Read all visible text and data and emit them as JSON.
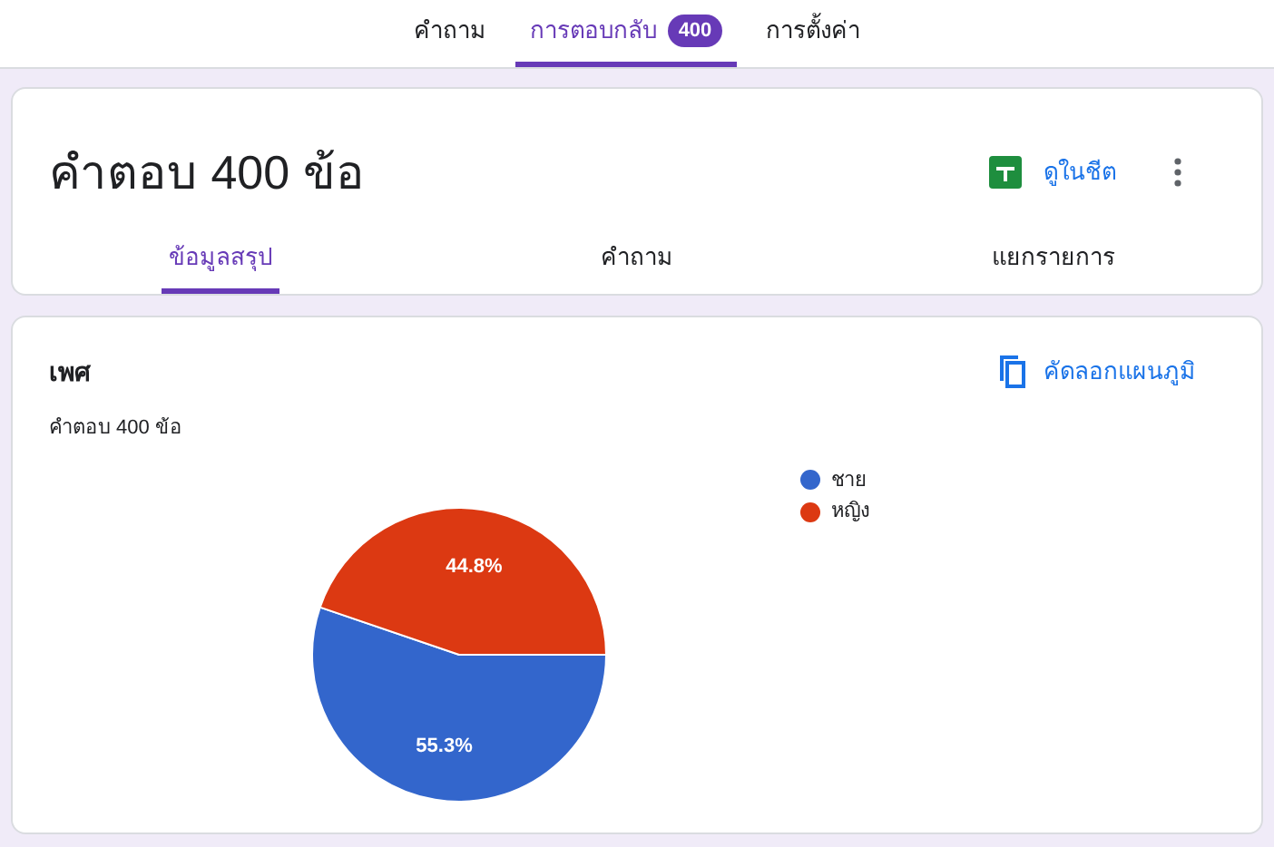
{
  "top_tabs": [
    {
      "label": "คำถาม",
      "selected": false
    },
    {
      "label": "การตอบกลับ",
      "selected": true,
      "badge": "400"
    },
    {
      "label": "การตั้งค่า",
      "selected": false
    }
  ],
  "header": {
    "title": "คำตอบ 400 ข้อ",
    "sheet_link": "ดูในชีต"
  },
  "view_tabs": [
    {
      "label": "ข้อมูลสรุป",
      "selected": true
    },
    {
      "label": "คำถาม",
      "selected": false
    },
    {
      "label": "แยกรายการ",
      "selected": false
    }
  ],
  "question_card": {
    "title": "เพศ",
    "subtitle": "คำตอบ 400 ข้อ",
    "copy_button": "คัดลอกแผนภูมิ",
    "chart_data": {
      "type": "pie",
      "categories": [
        "ชาย",
        "หญิง"
      ],
      "values": [
        55.3,
        44.8
      ],
      "colors": [
        "#3366cc",
        "#dc3912"
      ],
      "value_labels": [
        "55.3%",
        "44.8%"
      ],
      "legend": "right"
    }
  }
}
